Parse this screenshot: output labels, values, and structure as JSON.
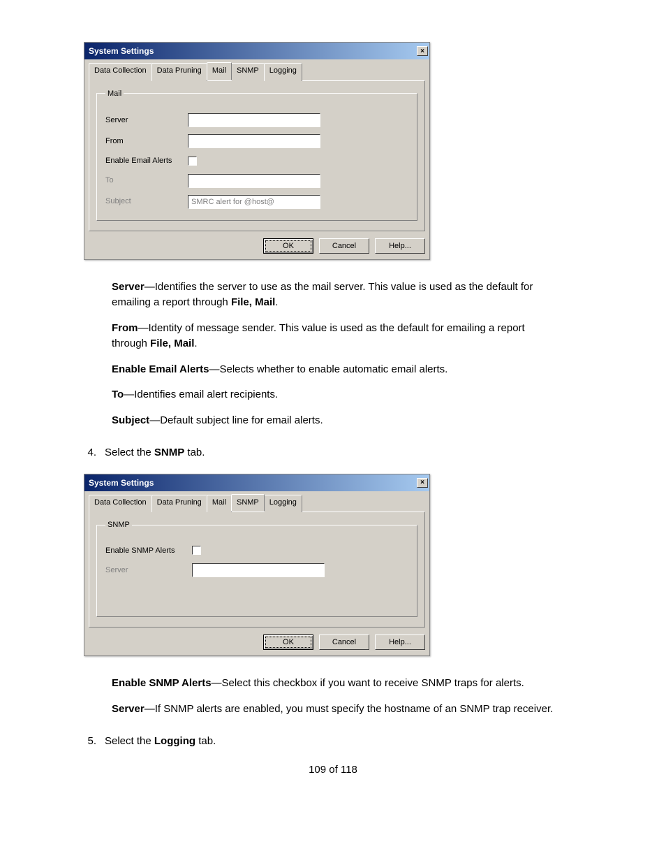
{
  "dialog1": {
    "title": "System Settings",
    "tabs": [
      "Data Collection",
      "Data Pruning",
      "Mail",
      "SNMP",
      "Logging"
    ],
    "active_tab": "Mail",
    "group_legend": "Mail",
    "labels": {
      "server": "Server",
      "from": "From",
      "enable": "Enable Email Alerts",
      "to": "To",
      "subject": "Subject"
    },
    "fields": {
      "server": "",
      "from": "",
      "enable_checked": false,
      "to": "",
      "subject": "SMRC alert for @host@"
    },
    "buttons": {
      "ok": "OK",
      "cancel": "Cancel",
      "help": "Help..."
    }
  },
  "desc1": {
    "server_label": "Server",
    "server_text": "—Identifies the server to use as the mail server. This value is used as the default for emailing a report through ",
    "server_tail_bold": "File, Mail",
    "server_tail": ".",
    "from_label": "From",
    "from_text": "—Identity of message sender. This value is used as the default for emailing a report through ",
    "from_tail_bold": "File, Mail",
    "from_tail": ".",
    "enable_label": "Enable Email Alerts",
    "enable_text": "—Selects whether to enable automatic email alerts.",
    "to_label": "To",
    "to_text": "—Identifies email alert recipients.",
    "subject_label": "Subject",
    "subject_text": "—Default subject line for email alerts."
  },
  "step4": {
    "num": "4.",
    "prefix": "Select the ",
    "bold": "SNMP",
    "suffix": " tab."
  },
  "dialog2": {
    "title": "System Settings",
    "tabs": [
      "Data Collection",
      "Data Pruning",
      "Mail",
      "SNMP",
      "Logging"
    ],
    "active_tab": "SNMP",
    "group_legend": "SNMP",
    "labels": {
      "enable": "Enable SNMP Alerts",
      "server": "Server"
    },
    "fields": {
      "enable_checked": false,
      "server": ""
    },
    "buttons": {
      "ok": "OK",
      "cancel": "Cancel",
      "help": "Help..."
    }
  },
  "desc2": {
    "enable_label": "Enable SNMP Alerts",
    "enable_text": "—Select this checkbox if you want to receive SNMP traps for alerts.",
    "server_label": "Server",
    "server_text": "—If SNMP alerts are enabled, you must specify the hostname of an SNMP trap receiver."
  },
  "step5": {
    "num": "5.",
    "prefix": "Select the ",
    "bold": "Logging",
    "suffix": " tab."
  },
  "page_number": "109 of 118"
}
